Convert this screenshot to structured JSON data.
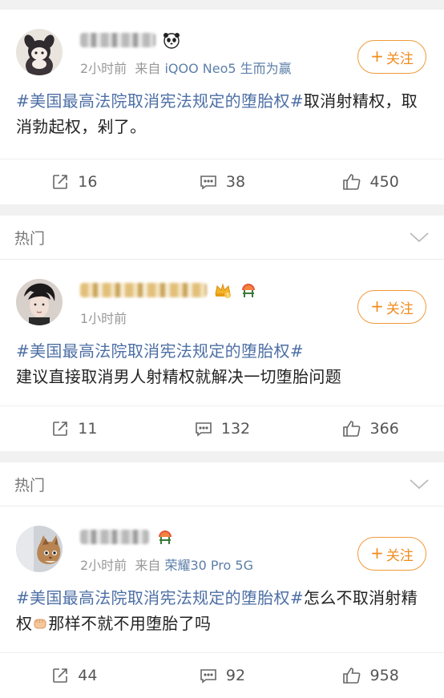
{
  "section_label": "热门",
  "follow_label": "关注",
  "posts": [
    {
      "time": "2小时前",
      "source_prefix": "来自",
      "device": "iQOO Neo5 生而为赢",
      "topic": "#美国最高法院取消宪法规定的堕胎权#",
      "text": "取消射精权，取消勃起权，剁了。",
      "reposts": "16",
      "comments": "38",
      "likes": "450",
      "badges": [
        "panda-icon"
      ]
    },
    {
      "time": "1小时前",
      "source_prefix": "",
      "device": "",
      "topic": "#美国最高法院取消宪法规定的堕胎权#",
      "text": "建议直接取消男人射精权就解决一切堕胎问题",
      "reposts": "11",
      "comments": "132",
      "likes": "366",
      "badges": [
        "crown-icon",
        "fan-badge-icon"
      ]
    },
    {
      "time": "2小时前",
      "source_prefix": "来自",
      "device": "荣耀30 Pro 5G",
      "topic": "#美国最高法院取消宪法规定的堕胎权#",
      "text_a": "怎么不取消射精权",
      "text_b": "那样不就不用堕胎了吗",
      "reposts": "44",
      "comments": "92",
      "likes": "958",
      "badges": [
        "fan-badge-icon"
      ]
    }
  ],
  "colors": {
    "accent": "#f08c1e",
    "topic": "#4d6fa5",
    "device": "#5d7fa8",
    "muted": "#999999"
  }
}
